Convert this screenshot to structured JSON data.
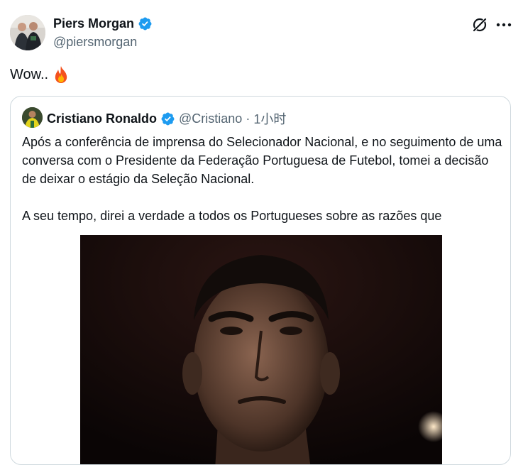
{
  "author": {
    "name": "Piers Morgan",
    "handle": "@piersmorgan"
  },
  "tweet": {
    "text": "Wow..",
    "emoji": "🔥",
    "emoji_icon": "fire-icon"
  },
  "quoted": {
    "name": "Cristiano Ronaldo",
    "handle": "@Cristiano",
    "separator": "·",
    "time": "1小时",
    "paragraphs": [
      "Após a conferência de imprensa do Selecionador Nacional, e no seguimento de uma conversa com o Presidente da Federação Portuguesa de Futebol, tomei a decisão de deixar o estágio da Seleção Nacional.",
      "A seu tempo, direi a verdade a todos os Portugueses sobre as razões que"
    ]
  },
  "icons": {
    "verified": "verified-badge-icon",
    "grok": "grok-icon",
    "more": "more-options-icon"
  },
  "colors": {
    "verified_blue": "#1d9bf0",
    "text_primary": "#0f1419",
    "text_secondary": "#536471",
    "border": "#cfd9de",
    "fire": "#f4511e"
  }
}
